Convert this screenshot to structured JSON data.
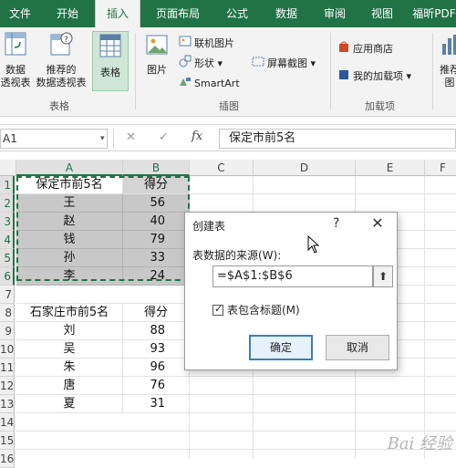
{
  "tabs": [
    "文件",
    "开始",
    "插入",
    "页面布局",
    "公式",
    "数据",
    "审阅",
    "视图",
    "福昕PDF"
  ],
  "active_tab": "插入",
  "ribbon": {
    "tables_group": {
      "label": "表格",
      "pivot_label_1": "数据",
      "pivot_label_2": "透视表",
      "recommended_label_1": "推荐的",
      "recommended_label_2": "数据透视表",
      "table_label": "表格"
    },
    "illustrations_group": {
      "label": "插图",
      "picture_label": "图片",
      "online_pictures": "联机图片",
      "shapes": "形状",
      "smartart": "SmartArt",
      "screenshot": "屏幕截图"
    },
    "addins_group": {
      "label": "加载项",
      "store": "应用商店",
      "my_addins": "我的加载项"
    },
    "recommended_charts_1": "推荐",
    "recommended_charts_2": "图"
  },
  "formula_bar": {
    "name_box": "A1",
    "cancel": "✕",
    "enter": "✓",
    "fx": "fx",
    "value": "保定市前5名"
  },
  "columns": [
    "A",
    "B",
    "C",
    "D",
    "E",
    "F"
  ],
  "rows": [
    "1",
    "2",
    "3",
    "4",
    "5",
    "6",
    "7",
    "8",
    "9",
    "10",
    "11",
    "12",
    "13",
    "14",
    "15",
    "16"
  ],
  "table1": {
    "header": [
      "保定市前5名",
      "得分"
    ],
    "rows": [
      [
        "王",
        "56"
      ],
      [
        "赵",
        "40"
      ],
      [
        "钱",
        "79"
      ],
      [
        "孙",
        "33"
      ],
      [
        "李",
        "24"
      ]
    ]
  },
  "table2": {
    "header": [
      "石家庄市前5名",
      "得分"
    ],
    "rows": [
      [
        "刘",
        "88"
      ],
      [
        "吴",
        "93"
      ],
      [
        "朱",
        "96"
      ],
      [
        "唐",
        "76"
      ],
      [
        "夏",
        "31"
      ]
    ]
  },
  "dialog": {
    "title": "创建表",
    "help": "?",
    "close": "✕",
    "source_label": "表数据的来源(W):",
    "source_value": "=$A$1:$B$6",
    "collapse": "⬆",
    "has_headers": "表包含标题(M)",
    "has_headers_checked": true,
    "ok": "确定",
    "cancel": "取消"
  },
  "watermark": "Bai 经验"
}
